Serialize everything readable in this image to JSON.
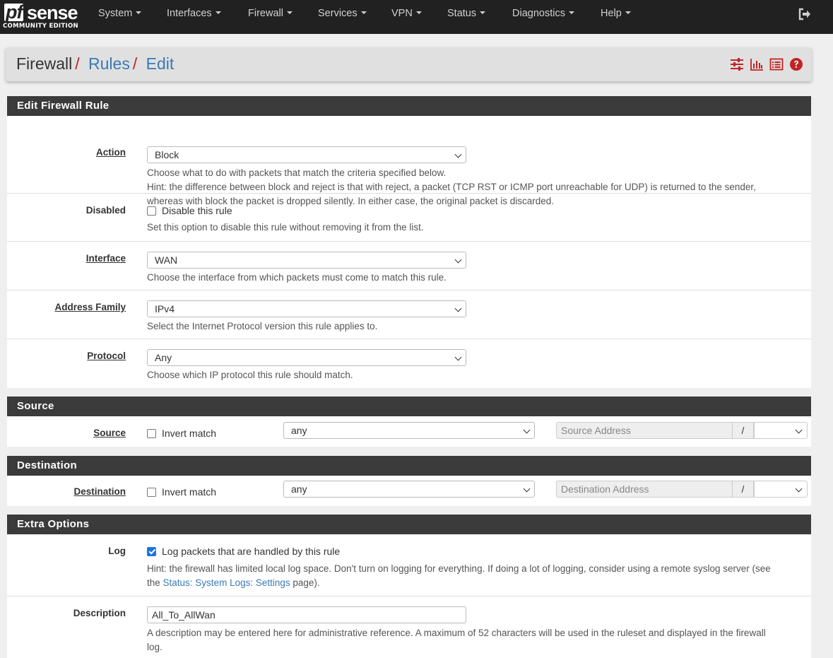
{
  "brand": {
    "name_pf": "pf",
    "name_sense": "sense",
    "edition": "COMMUNITY EDITION"
  },
  "nav": {
    "items": [
      {
        "label": "System"
      },
      {
        "label": "Interfaces"
      },
      {
        "label": "Firewall"
      },
      {
        "label": "Services"
      },
      {
        "label": "VPN"
      },
      {
        "label": "Status"
      },
      {
        "label": "Diagnostics"
      },
      {
        "label": "Help"
      }
    ],
    "logout_icon": "sign-out-icon"
  },
  "breadcrumb": {
    "items": [
      "Firewall",
      "Rules",
      "Edit"
    ],
    "separator": "/",
    "icons": [
      "sliders-icon",
      "bar-chart-icon",
      "list-icon",
      "question-circle-icon"
    ]
  },
  "edit_rule": {
    "title": "Edit Firewall Rule",
    "action": {
      "label": "Action",
      "value": "Block",
      "help1": "Choose what to do with packets that match the criteria specified below.",
      "help2": "Hint: the difference between block and reject is that with reject, a packet (TCP RST or ICMP port unreachable for UDP) is returned to the sender,",
      "help3": "whereas with block the packet is dropped silently. In either case, the original packet is discarded."
    },
    "disabled": {
      "label": "Disabled",
      "checkbox_label": "Disable this rule",
      "checked": false,
      "help": "Set this option to disable this rule without removing it from the list."
    },
    "interface": {
      "label": "Interface",
      "value": "WAN",
      "help": "Choose the interface from which packets must come to match this rule."
    },
    "address_family": {
      "label": "Address Family",
      "value": "IPv4",
      "help": "Select the Internet Protocol version this rule applies to."
    },
    "protocol": {
      "label": "Protocol",
      "value": "Any",
      "help": "Choose which IP protocol this rule should match."
    }
  },
  "source": {
    "title": "Source",
    "label": "Source",
    "invert_label": "Invert match",
    "invert_checked": false,
    "type_value": "any",
    "address_placeholder": "Source Address",
    "slash": "/"
  },
  "destination": {
    "title": "Destination",
    "label": "Destination",
    "invert_label": "Invert match",
    "invert_checked": false,
    "type_value": "any",
    "address_placeholder": "Destination Address",
    "slash": "/"
  },
  "extra": {
    "title": "Extra Options",
    "log": {
      "label": "Log",
      "checkbox_label": "Log packets that are handled by this rule",
      "checked": true,
      "help1": "Hint: the firewall has limited local log space. Don't turn on logging for everything. If doing a lot of logging, consider using a remote syslog server (see",
      "help2_prefix": "the ",
      "help2_link": "Status: System Logs: Settings",
      "help2_suffix": " page)."
    },
    "description": {
      "label": "Description",
      "value": "All_To_AllWan",
      "help1": "A description may be entered here for administrative reference. A maximum of 52 characters will be used in the ruleset and displayed in the firewall",
      "help2": "log."
    }
  },
  "colors": {
    "navbar": "#212121",
    "panel_header": "#3b3b3b",
    "accent_red": "#c12424",
    "link_blue": "#3a7ab6"
  }
}
